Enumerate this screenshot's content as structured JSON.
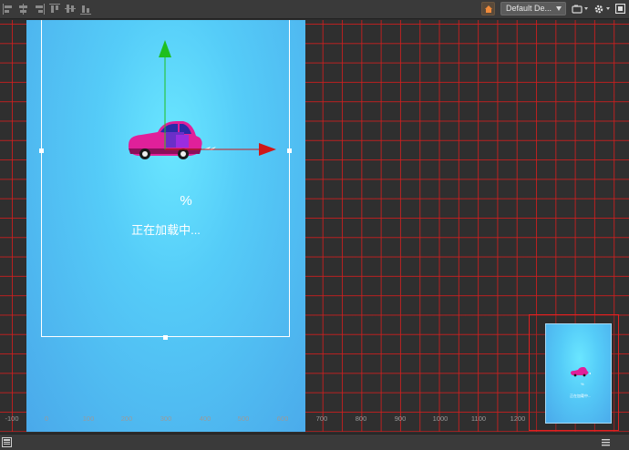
{
  "toolbar": {
    "align_buttons": [
      "align-left-icon",
      "align-center-h-icon",
      "align-right-icon",
      "align-top-icon",
      "align-middle-v-icon",
      "align-bottom-icon"
    ],
    "device_select": {
      "value": "Default De..."
    },
    "icons": [
      "home-icon",
      "camera-icon",
      "gear-icon",
      "layout-icon"
    ]
  },
  "scene": {
    "percent_text": "%",
    "loading_text": "正在加载中...",
    "axis_labels": [
      "-100",
      "0",
      "100",
      "200",
      "300",
      "400",
      "500",
      "600",
      "700",
      "800",
      "900",
      "1000",
      "1100",
      "1200"
    ],
    "colors": {
      "grid": "#d21e1e",
      "canvas": "#55ccf8",
      "gizmo_y": "#1fbf1f",
      "gizmo_x": "#d01818",
      "car_body": "#e0209a"
    },
    "minimap": {
      "loading_text": "正在加载中..."
    }
  },
  "bottombar": {
    "icons": [
      "panel-icon",
      "menu-icon"
    ]
  }
}
